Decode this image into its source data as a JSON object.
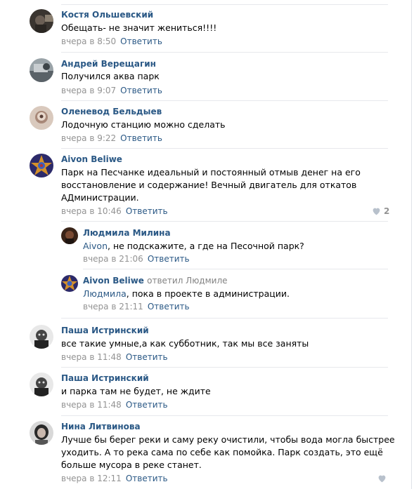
{
  "comments": [
    {
      "name": "Костя Ольшевский",
      "text": "Обещать- не значит жениться!!!!",
      "time": "вчера в 8:50",
      "reply": "Ответить"
    },
    {
      "name": "Андрей Верещагин",
      "text": "Получился аква парк",
      "time": "вчера в 9:07",
      "reply": "Ответить"
    },
    {
      "name": "Оленевод Бельдыев",
      "text": "Лодочную станцию можно сделать",
      "time": "вчера в 9:22",
      "reply": "Ответить"
    },
    {
      "name": "Aivon Beliwe",
      "text_lines": [
        "Парк на Песчанке идеальный и постоянный отмыв денег на его",
        "восстановление и содержание! Вечный двигатель для откатов",
        "АДминистрации."
      ],
      "time": "вчера в 10:46",
      "reply": "Ответить",
      "likes": "2"
    },
    {
      "name": "Людмила Милина",
      "mention": "Aivon",
      "text": ", не подскажите, а где на Песочной парк?",
      "time": "вчера в 21:06",
      "reply": "Ответить"
    },
    {
      "name": "Aivon Beliwe",
      "replied_to": "ответил Людмиле",
      "mention": "Людмила",
      "text": ", пока в проекте в администрации.",
      "time": "вчера в 21:11",
      "reply": "Ответить"
    },
    {
      "name": "Паша Истринский",
      "text": "все такие умные,а как субботник, так мы все заняты",
      "time": "вчера в 11:48",
      "reply": "Ответить"
    },
    {
      "name": "Паша Истринский",
      "text": "и парка там не будет, не ждите",
      "time": "вчера в 11:48",
      "reply": "Ответить"
    },
    {
      "name": "Нина Литвинова",
      "text_lines": [
        "Лучше бы берег реки и саму реку очистили, чтобы вода могла быстрее",
        "уходить. А то река сама по себе как помойка. Парк создать, это ещё",
        "больше мусора в реке станет."
      ],
      "time": "вчера в 12:11",
      "reply": "Ответить"
    }
  ]
}
